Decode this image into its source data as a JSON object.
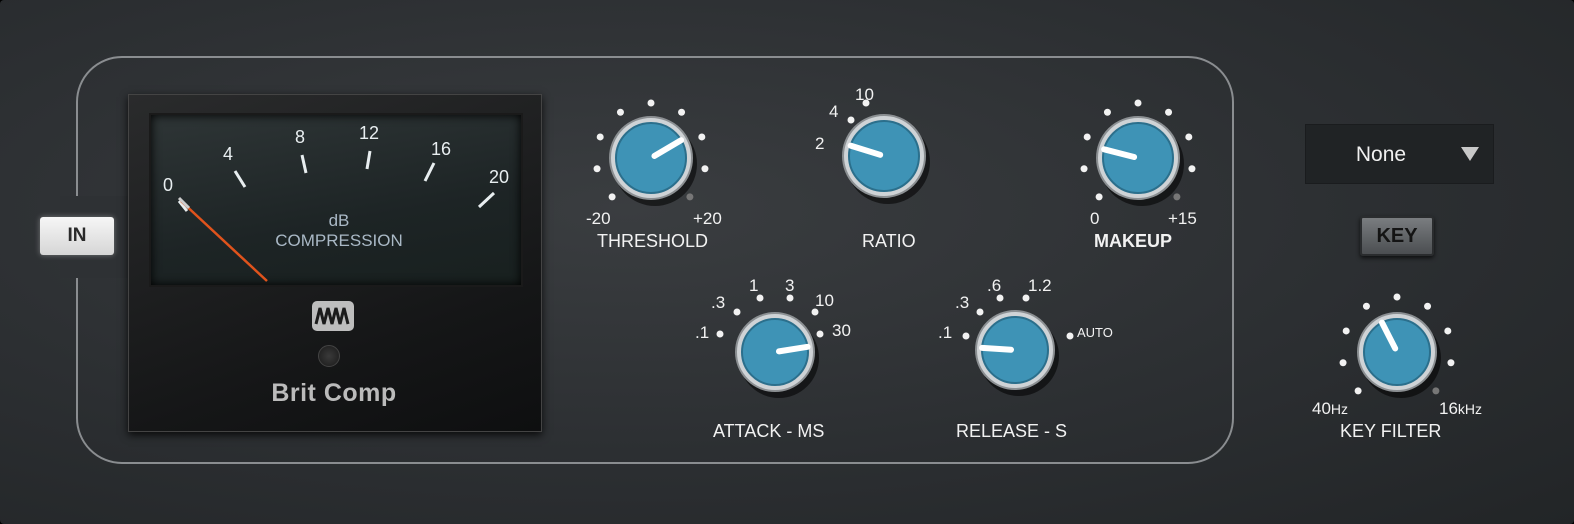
{
  "in_button": {
    "label": "IN"
  },
  "meter": {
    "scale": [
      "0",
      "4",
      "8",
      "12",
      "16",
      "20"
    ],
    "unit": "dB",
    "label": "COMPRESSION",
    "brand": "Brit Comp",
    "reading_db": 0
  },
  "knobs": [
    {
      "id": "threshold",
      "label": "THRESHOLD",
      "min": "-20",
      "max": "+20",
      "value_fraction": 0.72
    },
    {
      "id": "ratio",
      "label": "RATIO",
      "scale": [
        "2",
        "4",
        "10"
      ],
      "value": "2"
    },
    {
      "id": "makeup",
      "label": "MAKEUP",
      "min": "0",
      "max": "+15",
      "value_fraction": 0.22
    },
    {
      "id": "attack",
      "label": "ATTACK - MS",
      "scale": [
        ".1",
        ".3",
        "1",
        "3",
        "10",
        "30"
      ],
      "value_fraction": 0.8
    },
    {
      "id": "release",
      "label": "RELEASE - S",
      "scale": [
        ".1",
        ".3",
        ".6",
        "1.2",
        "AUTO"
      ],
      "value_fraction": 0.18
    },
    {
      "id": "key_filter",
      "label": "KEY FILTER",
      "min": "40",
      "min_unit": "Hz",
      "max": "16",
      "max_unit": "kHz",
      "value_fraction": 0.4
    }
  ],
  "sidechain": {
    "selected": "None"
  },
  "key_button": {
    "label": "KEY"
  },
  "colors": {
    "knob": "#3e93b6",
    "needle": "#e0531c",
    "panel": "#2e3134"
  }
}
